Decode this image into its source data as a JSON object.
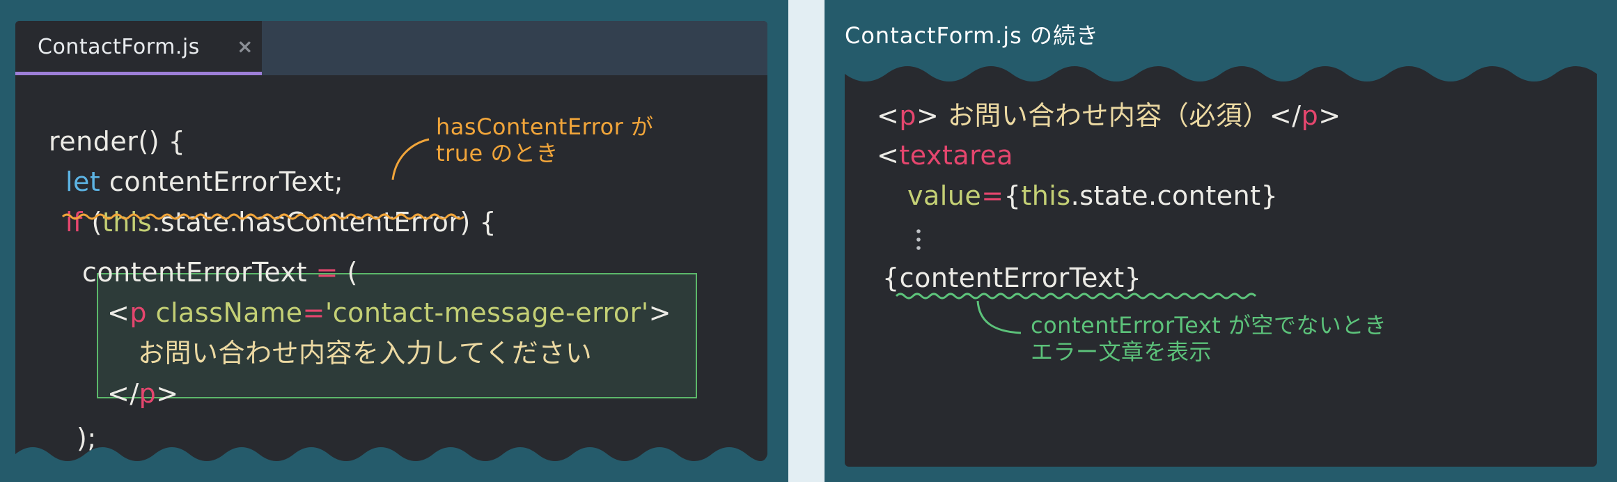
{
  "left_panel": {
    "tab": {
      "label": "ContactForm.js",
      "close_icon": "×"
    },
    "code": {
      "l1_render": "render() {",
      "l2_let": "let",
      "l2_rest": " contentErrorText;",
      "l3_if": "if",
      "l3_open": " (",
      "l3_this": "this",
      "l3_rest": ".state.hasContentError) {",
      "l4_name": "contentErrorText ",
      "l4_eq": "=",
      "l4_paren": " (",
      "l5_lt": "<",
      "l5_p": "p",
      "l5_attr": " className",
      "l5_eq": "=",
      "l5_value": "'contact-message-error'",
      "l5_gt": ">",
      "l6_text": "お問い合わせ内容を入力してください",
      "l7_open": "</",
      "l7_p": "p",
      "l7_gt": ">",
      "l8_close": ");"
    },
    "annotation": {
      "line1": "hasContentError が",
      "line2": "true のとき"
    }
  },
  "right_panel": {
    "title": "ContactForm.js の続き",
    "code": {
      "l1_lt": "<",
      "l1_p": "p",
      "l1_gt": "> ",
      "l1_text": "お問い合わせ内容（必須）",
      "l1_close_lt": "</",
      "l1_close_p": "p",
      "l1_close_gt": ">",
      "l2_lt": "<",
      "l2_tag": "textarea",
      "l3_attr": "value",
      "l3_eq": "=",
      "l3_open": "{",
      "l3_this": "this",
      "l3_rest": ".state.content}",
      "l5_expr": "{contentErrorText}"
    },
    "annotation": {
      "line1": "contentErrorText が空でないとき",
      "line2": "エラー文章を表示"
    }
  },
  "colors": {
    "background": "#255b6b",
    "editor": "#282a2f",
    "tab_accent": "#9d7fd8",
    "keyword_red": "#e5466e",
    "keyword_blue": "#5cb3e3",
    "attribute_olive": "#c4d075",
    "japanese_text": "#ecd9a2",
    "annotation_orange": "#f1a53a",
    "annotation_green": "#5cc27a"
  }
}
